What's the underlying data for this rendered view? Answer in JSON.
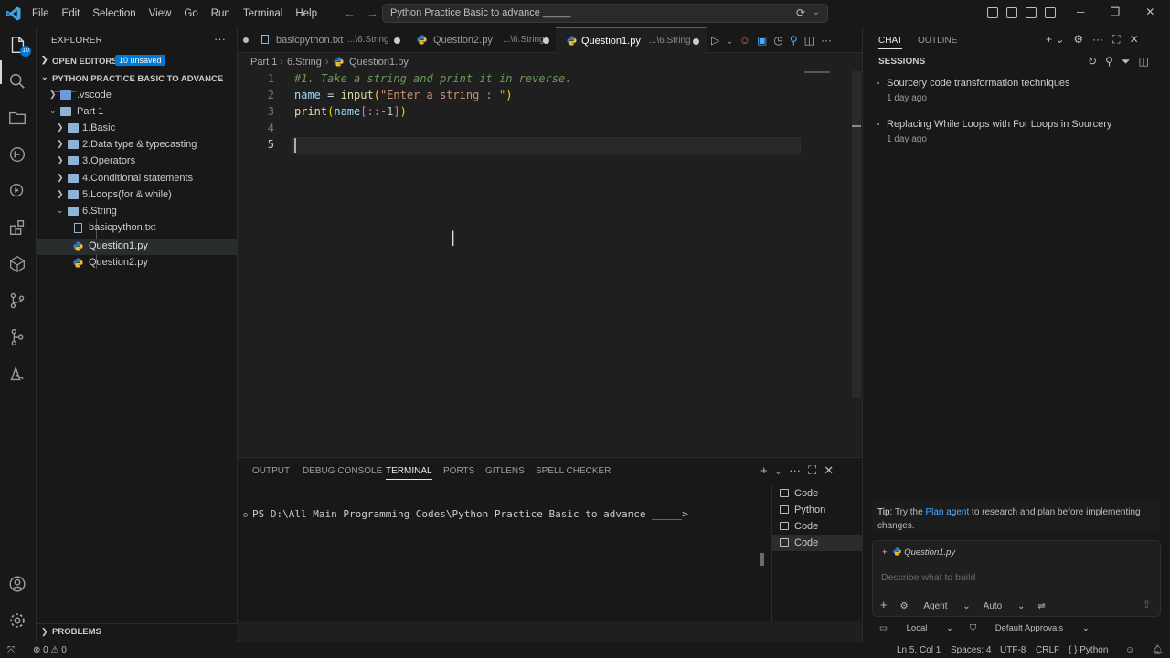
{
  "titlebar": {
    "menu": [
      "File",
      "Edit",
      "Selection",
      "View",
      "Go",
      "Run",
      "Terminal",
      "Help"
    ],
    "search_text": "Python Practice Basic to advance _____"
  },
  "activity": {
    "badge": "10"
  },
  "sidebar": {
    "title": "EXPLORER",
    "open_editors": {
      "label": "OPEN EDITORS",
      "badge": "10 unsaved"
    },
    "workspace": "PYTHON PRACTICE BASIC TO ADVANCE _____",
    "tree": [
      {
        "label": ".vscode"
      },
      {
        "label": "Part 1"
      },
      {
        "label": "1.Basic"
      },
      {
        "label": "2.Data type & typecasting"
      },
      {
        "label": "3.Operators"
      },
      {
        "label": "4.Conditional statements"
      },
      {
        "label": "5.Loops(for & while)"
      },
      {
        "label": "6.String"
      },
      {
        "label": "basicpython.txt"
      },
      {
        "label": "Question1.py"
      },
      {
        "label": "Question2.py"
      }
    ],
    "problems": "PROBLEMS"
  },
  "tabs": [
    {
      "name": "basicpython.txt",
      "desc": "...\\6.String"
    },
    {
      "name": "Question2.py",
      "desc": "...\\6.String"
    },
    {
      "name": "Question1.py",
      "desc": "...\\6.String"
    }
  ],
  "breadcrumb": [
    "Part 1",
    "6.String",
    "Question1.py"
  ],
  "editor": {
    "line_numbers": [
      "1",
      "2",
      "3",
      "4",
      "5"
    ],
    "code": {
      "l1_comment": "#1. Take a string and print it in reverse.",
      "l2_var": "name",
      "l2_eq": " = ",
      "l2_fn": "input",
      "l2_open": "(",
      "l2_str": "\"Enter a string : \"",
      "l2_close": ")",
      "l3_fn": "print",
      "l3_open": "(",
      "l3_var": "name",
      "l3_slice": "[::-",
      "l3_num": "1",
      "l3_slice_end": "]",
      "l3_close": ")"
    }
  },
  "panel": {
    "tabs": [
      "OUTPUT",
      "DEBUG CONSOLE",
      "TERMINAL",
      "PORTS",
      "GITLENS",
      "SPELL CHECKER"
    ],
    "prompt": "PS D:\\All Main Programming Codes\\Python Practice Basic to advance _____>",
    "terminals": [
      "Code",
      "Python",
      "Code",
      "Code"
    ]
  },
  "chat": {
    "tabs": [
      "CHAT",
      "OUTLINE"
    ],
    "sessions_title": "SESSIONS",
    "sessions": [
      {
        "title": "Sourcery code transformation techniques",
        "when": "1 day ago"
      },
      {
        "title": "Replacing While Loops with For Loops in Sourcery",
        "when": "1 day ago"
      }
    ],
    "tip_label": "Tip:",
    "tip_pre": " Try the ",
    "tip_link": "Plan agent",
    "tip_post": " to research and plan before implementing changes.",
    "context_file": "Question1.py",
    "placeholder": "Describe what to build",
    "mode": "Agent",
    "model": "Auto",
    "footer_left": "Local",
    "footer_right": "Default Approvals"
  },
  "statusbar": {
    "problems": "0",
    "warnings": "0",
    "position": "Ln 5, Col 1",
    "spaces": "Spaces: 4",
    "encoding": "UTF-8",
    "eol": "CRLF",
    "language": "Python"
  }
}
